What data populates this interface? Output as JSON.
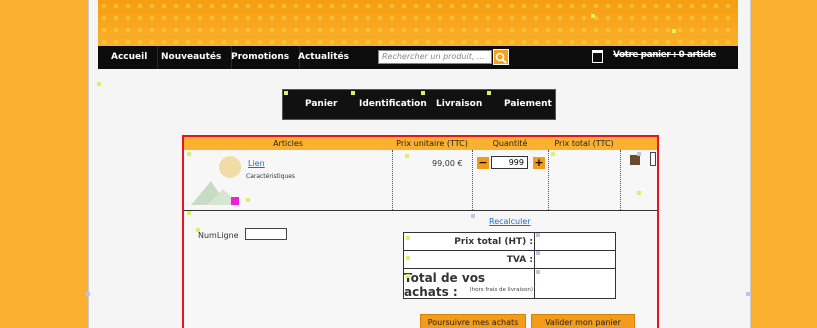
{
  "nav": {
    "items": [
      "Accueil",
      "Nouveautés",
      "Promotions",
      "Actualités"
    ],
    "search_placeholder": "Rechercher un produit, ...",
    "cart_label": "Votre panier : 0 article"
  },
  "steps": [
    "Panier",
    "Identification",
    "Livraison",
    "Paiement"
  ],
  "cart": {
    "headers": {
      "articles": "Articles",
      "unit_price": "Prix unitaire (TTC)",
      "quantity": "Quantité",
      "total_price": "Prix total (TTC)"
    },
    "item": {
      "link": "Lien",
      "characteristics": "Caractéristiques",
      "unit_price": "99,00 €",
      "quantity": "999"
    },
    "qty_minus": "−",
    "qty_plus": "+",
    "recalc_label": "Recalculer",
    "numligne_label": "NumLigne"
  },
  "totals": {
    "ht_label": "Prix total (HT) :",
    "tva_label": "TVA :",
    "total_label": "Total de vos achats :",
    "frais_note": "(hors frais de livraison)"
  },
  "actions": {
    "continue_label": "Poursuivre mes achats",
    "validate_label": "Valider mon panier"
  },
  "colors": {
    "background": "#fbb02f",
    "accent": "#f39b1b",
    "cart_border": "#e8141e"
  }
}
